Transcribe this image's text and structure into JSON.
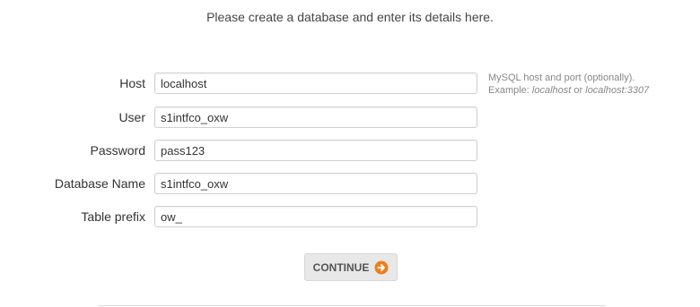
{
  "intro_text": "Please create a database and enter its details here.",
  "fields": {
    "host": {
      "label": "Host",
      "value": "localhost"
    },
    "user": {
      "label": "User",
      "value": "s1intfco_oxw"
    },
    "password": {
      "label": "Password",
      "value": "pass123"
    },
    "database_name": {
      "label": "Database Name",
      "value": "s1intfco_oxw"
    },
    "table_prefix": {
      "label": "Table prefix",
      "value": "ow_"
    }
  },
  "host_hint": {
    "line1": "MySQL host and port (optionally).",
    "example_prefix": "Example: ",
    "example_1": "localhost",
    "or_text": " or ",
    "example_2": "localhost:3307"
  },
  "continue_button": {
    "label": "CONTINUE",
    "icon": "arrow-right-circle-icon",
    "icon_color": "#f07d1a"
  }
}
